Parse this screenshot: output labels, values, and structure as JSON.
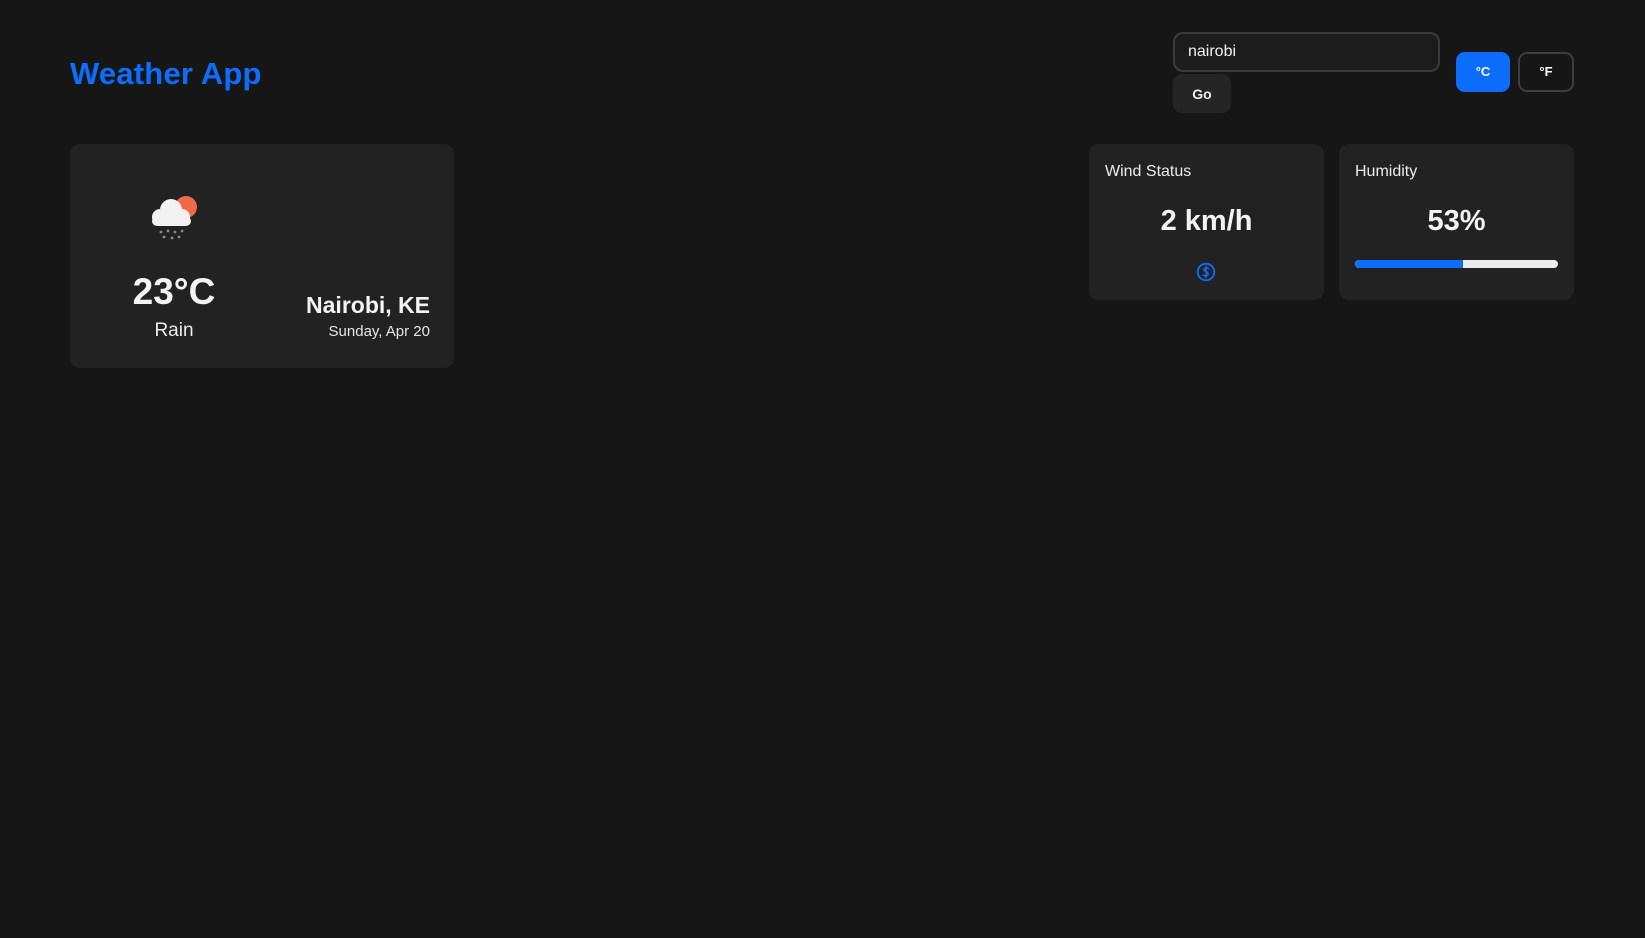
{
  "app": {
    "title": "Weather App",
    "accent_color": "#0d6efd",
    "background_color": "#161616",
    "card_color": "#222222"
  },
  "search": {
    "value": "nairobi",
    "placeholder": "",
    "submit_label": "Go"
  },
  "units": {
    "celsius_label": "°C",
    "fahrenheit_label": "°F",
    "selected": "celsius"
  },
  "current": {
    "icon": "rain-cloud-sun-icon",
    "temperature": "23°C",
    "condition": "Rain",
    "location": "Nairobi, KE",
    "date": "Sunday, Apr 20"
  },
  "wind": {
    "label": "Wind Status",
    "value": "2 km/h",
    "direction_icon": "wind-direction-icon"
  },
  "humidity": {
    "label": "Humidity",
    "value": "53%",
    "percent": 53
  }
}
